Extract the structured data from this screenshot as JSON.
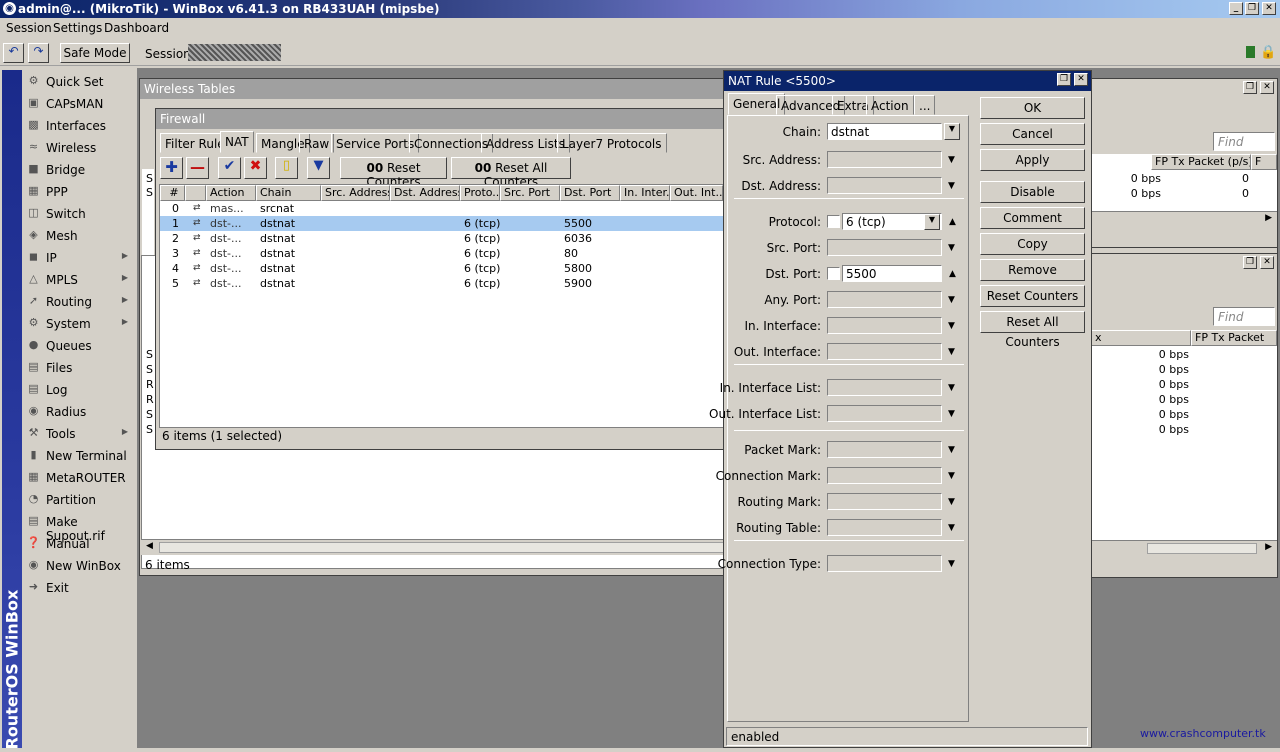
{
  "window": {
    "title": "admin@... (MikroTik) - WinBox v6.41.3 on RB433UAH (mipsbe)"
  },
  "menu": [
    "Session",
    "Settings",
    "Dashboard"
  ],
  "toolbar": {
    "safe_mode": "Safe Mode",
    "session_label": "Session:"
  },
  "sidebar": {
    "brand": "RouterOS WinBox",
    "items": [
      "Quick Set",
      "CAPsMAN",
      "Interfaces",
      "Wireless",
      "Bridge",
      "PPP",
      "Switch",
      "Mesh",
      "IP",
      "MPLS",
      "Routing",
      "System",
      "Queues",
      "Files",
      "Log",
      "Radius",
      "Tools",
      "New Terminal",
      "MetaROUTER",
      "Partition",
      "Make Supout.rif",
      "Manual",
      "New WinBox",
      "Exit"
    ]
  },
  "wireless": {
    "title": "Wireless Tables",
    "items": "6 items",
    "find": "Find",
    "col_fp_tx_packet": "FP Tx Packet (p/s)",
    "col_f": "F",
    "col_fp_tx_packet2": "FP Tx Packet",
    "col_x": "x",
    "rows1": [
      [
        "0 bps",
        "0"
      ],
      [
        "0 bps",
        "0"
      ]
    ],
    "rows2": [
      "0 bps",
      "0 bps",
      "0 bps",
      "0 bps",
      "0 bps",
      "0 bps"
    ],
    "left_letters": [
      "S",
      "S",
      "R",
      "R",
      "S",
      "S"
    ]
  },
  "firewall": {
    "title": "Firewall",
    "tabs": [
      "Filter Rules",
      "NAT",
      "Mangle",
      "Raw",
      "Service Ports",
      "Connections",
      "Address Lists",
      "Layer7 Protocols"
    ],
    "reset_counters": "Reset Counters",
    "reset_all_counters": "Reset All Counters",
    "oo": "00",
    "columns": [
      "#",
      "Action",
      "Chain",
      "Src. Address",
      "Dst. Address",
      "Proto...",
      "Src. Port",
      "Dst. Port",
      "In. Inter...",
      "Out. Int..."
    ],
    "rows": [
      {
        "n": "0",
        "action": "mas...",
        "chain": "srcnat",
        "proto": "",
        "dport": ""
      },
      {
        "n": "1",
        "action": "dst-...",
        "chain": "dstnat",
        "proto": "6 (tcp)",
        "dport": "5500"
      },
      {
        "n": "2",
        "action": "dst-...",
        "chain": "dstnat",
        "proto": "6 (tcp)",
        "dport": "6036"
      },
      {
        "n": "3",
        "action": "dst-...",
        "chain": "dstnat",
        "proto": "6 (tcp)",
        "dport": "80"
      },
      {
        "n": "4",
        "action": "dst-...",
        "chain": "dstnat",
        "proto": "6 (tcp)",
        "dport": "5800"
      },
      {
        "n": "5",
        "action": "dst-...",
        "chain": "dstnat",
        "proto": "6 (tcp)",
        "dport": "5900"
      }
    ],
    "status": "6 items (1 selected)"
  },
  "nat": {
    "title": "NAT Rule <5500>",
    "tabs": [
      "General",
      "Advanced",
      "Extra",
      "Action",
      "..."
    ],
    "chain_label": "Chain:",
    "chain": "dstnat",
    "labels": [
      "Src. Address:",
      "Dst. Address:",
      "Protocol:",
      "Src. Port:",
      "Dst. Port:",
      "Any. Port:",
      "In. Interface:",
      "Out. Interface:",
      "In. Interface List:",
      "Out. Interface List:",
      "Packet Mark:",
      "Connection Mark:",
      "Routing Mark:",
      "Routing Table:",
      "Connection Type:"
    ],
    "protocol": "6 (tcp)",
    "dst_port": "5500",
    "buttons": [
      "OK",
      "Cancel",
      "Apply",
      "Disable",
      "Comment",
      "Copy",
      "Remove",
      "Reset Counters",
      "Reset All Counters"
    ],
    "status": "enabled"
  },
  "watermark": "www.crashcomputer.tk"
}
